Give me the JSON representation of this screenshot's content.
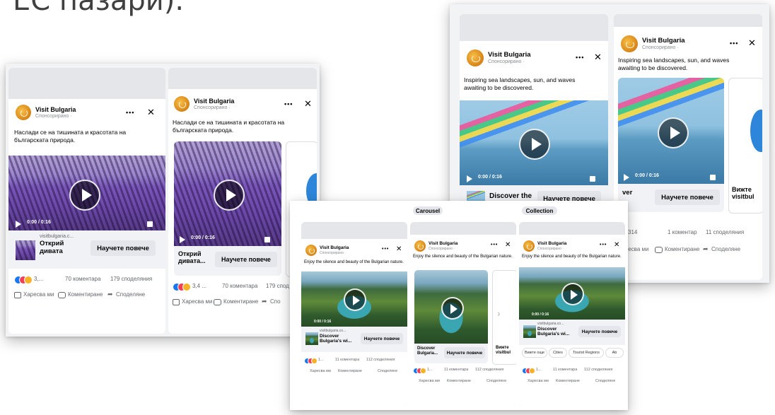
{
  "heading": "ЕС пазари).",
  "brand_name": "Visit Bulgaria",
  "sponsored_bg": "Спонсорирано · ",
  "more_icon": "•••",
  "close_icon": "✕",
  "panel_bg": {
    "caption": "Наслади се на тишината и красотата на българската природа.",
    "single": {
      "time": "0:00 / 0:16",
      "domain": "visitbulgaria.c...",
      "title": "Открий дивата",
      "cta": "Научете повече",
      "stats_count": "3,...",
      "comments": "70 коментара",
      "shares": "179 споделяния"
    },
    "carousel": {
      "time": "0:00 / 0:16",
      "title": "Открий дивата...",
      "cta": "Научете повече",
      "stats_count": "3,4 ...",
      "comments": "70 коментара",
      "shares": "179 спод"
    },
    "actions": {
      "like": "Харесва ми",
      "comment": "Коментиране",
      "share": "Споделяне"
    },
    "actions_short": {
      "like": "Харесва ми",
      "comment": "Коментиране",
      "share": "Спо"
    }
  },
  "panel_en": {
    "caption": "Inspiring sea landscapes, sun, and waves awaiting to be discovered.",
    "single": {
      "time": "0:00 / 0:16",
      "title": "Discover the",
      "cta": "Научете повече"
    },
    "carousel": {
      "time": "0:00 / 0:16",
      "title": "ver",
      "cta": "Научете повече",
      "next_title": "Вижте visitbul"
    },
    "stats": {
      "count": "314",
      "comments": "1 коментар",
      "shares": "11 споделяния"
    },
    "actions": {
      "like": "Харесва ми",
      "comment": "Коментиране",
      "share": "Споделяне"
    }
  },
  "panel_front": {
    "labels": {
      "carousel": "Carousel",
      "collection": "Collection"
    },
    "caption": "Enjoy the silence and beauty of the Bulgarian nature.",
    "single": {
      "time": "0:00 / 0:16",
      "domain": "visitbulgaria.co...",
      "title": "Discover Bulgaria's wi...",
      "cta": "Научете повече"
    },
    "carousel": {
      "title": "Discover Bulgaria...",
      "cta": "Научете повече",
      "next_title": "Вижте visitbul"
    },
    "collection": {
      "time": "0:00 / 0:16",
      "domain": "visitbulgaria.co...",
      "title": "Discover Bulgaria's wi...",
      "cta": "Научете повече",
      "tags": [
        "Вижте още",
        "Cities",
        "Tourist Regions",
        "Ab"
      ]
    },
    "stats": {
      "count": "1...",
      "comments": "11 коментара",
      "shares": "112 споделяния"
    },
    "actions": {
      "like": "Харесва ми",
      "comment": "Коментиране",
      "share": "Споделяне"
    }
  },
  "colors": {
    "fb_blue": "#1877f2",
    "love_red": "#f33e58",
    "haha_yellow": "#f7b125"
  }
}
